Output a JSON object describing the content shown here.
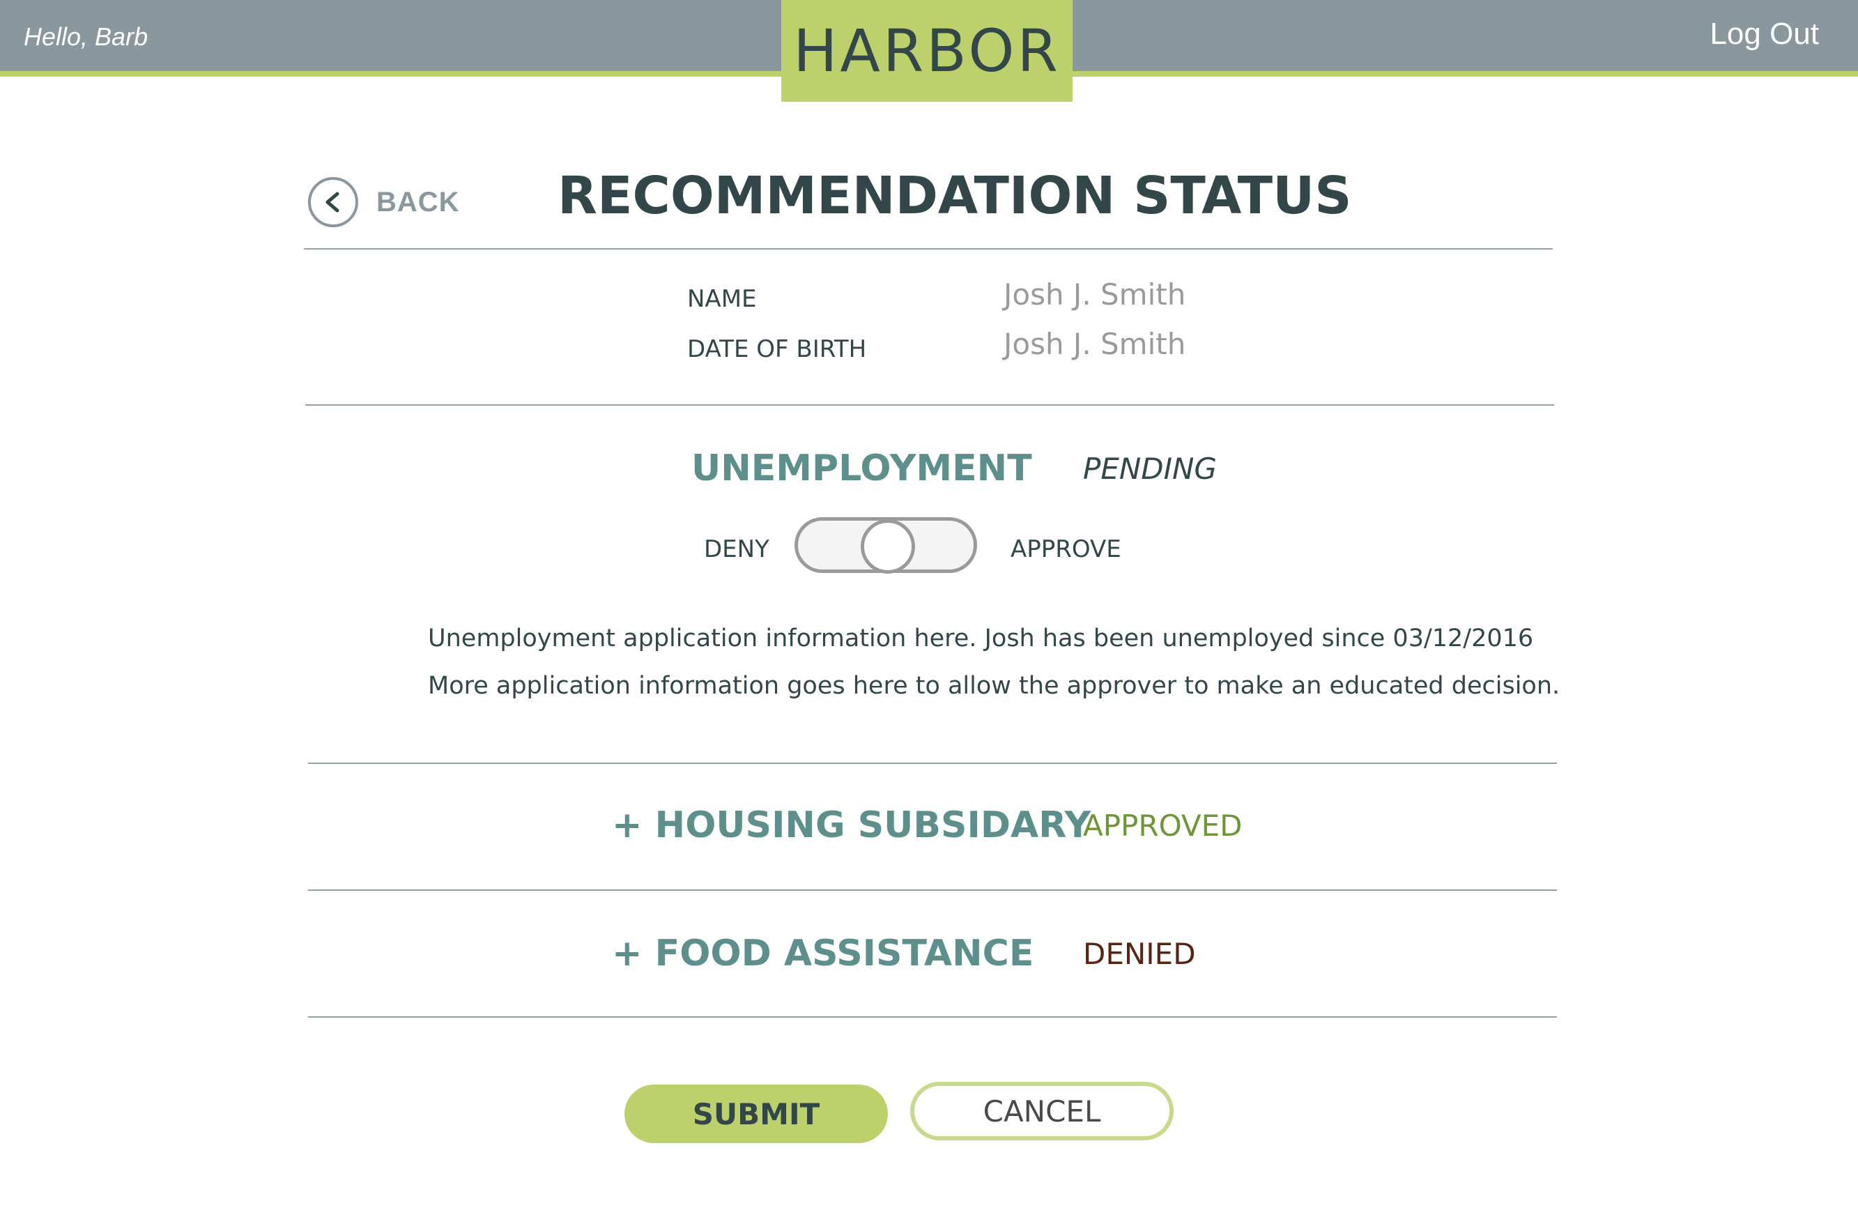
{
  "header": {
    "greeting": "Hello, Barb",
    "logo": "HARBOR",
    "logout_label": "Log Out"
  },
  "page": {
    "back_label": "BACK",
    "title": "RECOMMENDATION STATUS"
  },
  "applicant": {
    "name_label": "NAME",
    "name_value": "Josh J. Smith",
    "dob_label": "DATE OF BIRTH",
    "dob_value": "Josh J. Smith"
  },
  "programs": {
    "unemployment": {
      "name": "UNEMPLOYMENT",
      "status": "PENDING",
      "deny_label": "DENY",
      "approve_label": "APPROVE",
      "description_line1": "Unemployment application information here. Josh has been unemployed since 03/12/2016",
      "description_line2": "More application information goes here to allow the approver to make an educated decision."
    },
    "housing": {
      "name": "+ HOUSING SUBSIDARY",
      "status": "APPROVED"
    },
    "food": {
      "name": "+ FOOD ASSISTANCE",
      "status": "DENIED"
    }
  },
  "actions": {
    "submit_label": "SUBMIT",
    "cancel_label": "CANCEL"
  },
  "colors": {
    "header_bg": "#8a979c",
    "accent": "#bcd16c",
    "program_title": "#5d8f8c",
    "approved": "#6f9636",
    "denied": "#5a2413",
    "text_dark": "#33474a"
  }
}
